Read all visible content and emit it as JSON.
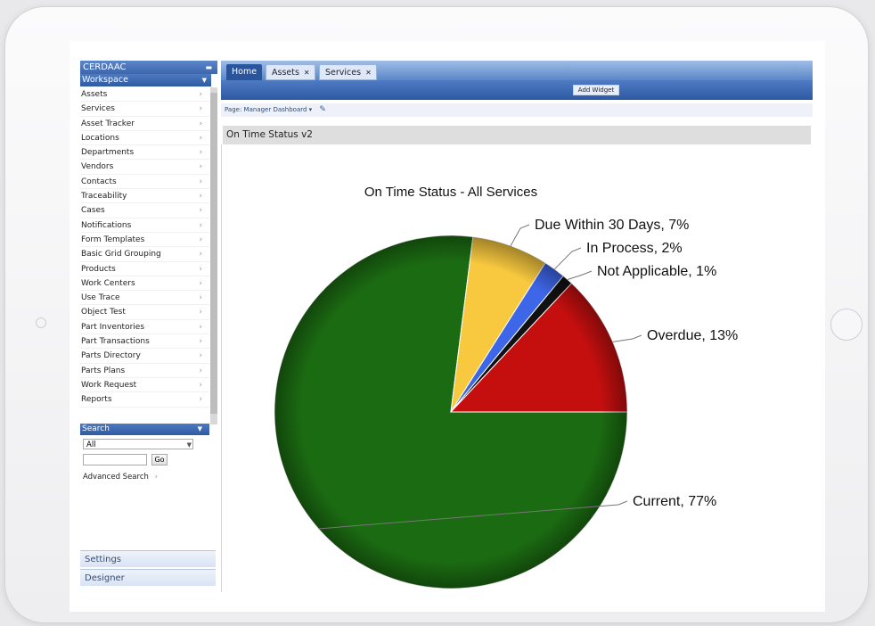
{
  "sidebar": {
    "brand": "CERDAAC",
    "workspace_label": "Workspace",
    "items": [
      "Assets",
      "Services",
      "Asset Tracker",
      "Locations",
      "Departments",
      "Vendors",
      "Contacts",
      "Traceability",
      "Cases",
      "Notifications",
      "Form Templates",
      "Basic Grid Grouping",
      "Products",
      "Work Centers",
      "Use Trace",
      "Object Test",
      "Part Inventories",
      "Part Transactions",
      "Parts Directory",
      "Parts Plans",
      "Work Request",
      "Reports"
    ],
    "search_label": "Search",
    "search_select_value": "All",
    "go_label": "Go",
    "advanced_search": "Advanced Search",
    "settings": "Settings",
    "designer": "Designer"
  },
  "tabs": [
    {
      "label": "Home"
    },
    {
      "label": "Assets"
    },
    {
      "label": "Services"
    }
  ],
  "toolbar": {
    "add_widget": "Add Widget"
  },
  "pagebar": {
    "page_label": "Page:",
    "page_value": "Manager Dashboard"
  },
  "widget": {
    "title": "On Time Status v2"
  },
  "chart_data": {
    "type": "pie",
    "title": "On Time Status - All Services",
    "slices": [
      {
        "label": "Current",
        "value": 77,
        "color": "#1b6b12",
        "display": "Current, 77%"
      },
      {
        "label": "Due Within 30 Days",
        "value": 7,
        "color": "#f8c93f",
        "display": "Due Within 30 Days, 7%"
      },
      {
        "label": "In Process",
        "value": 2,
        "color": "#3e66e8",
        "display": "In Process, 2%"
      },
      {
        "label": "Not Applicable",
        "value": 1,
        "color": "#111111",
        "display": "Not Applicable, 1%"
      },
      {
        "label": "Overdue",
        "value": 13,
        "color": "#c50f0f",
        "display": "Overdue, 13%"
      }
    ]
  }
}
